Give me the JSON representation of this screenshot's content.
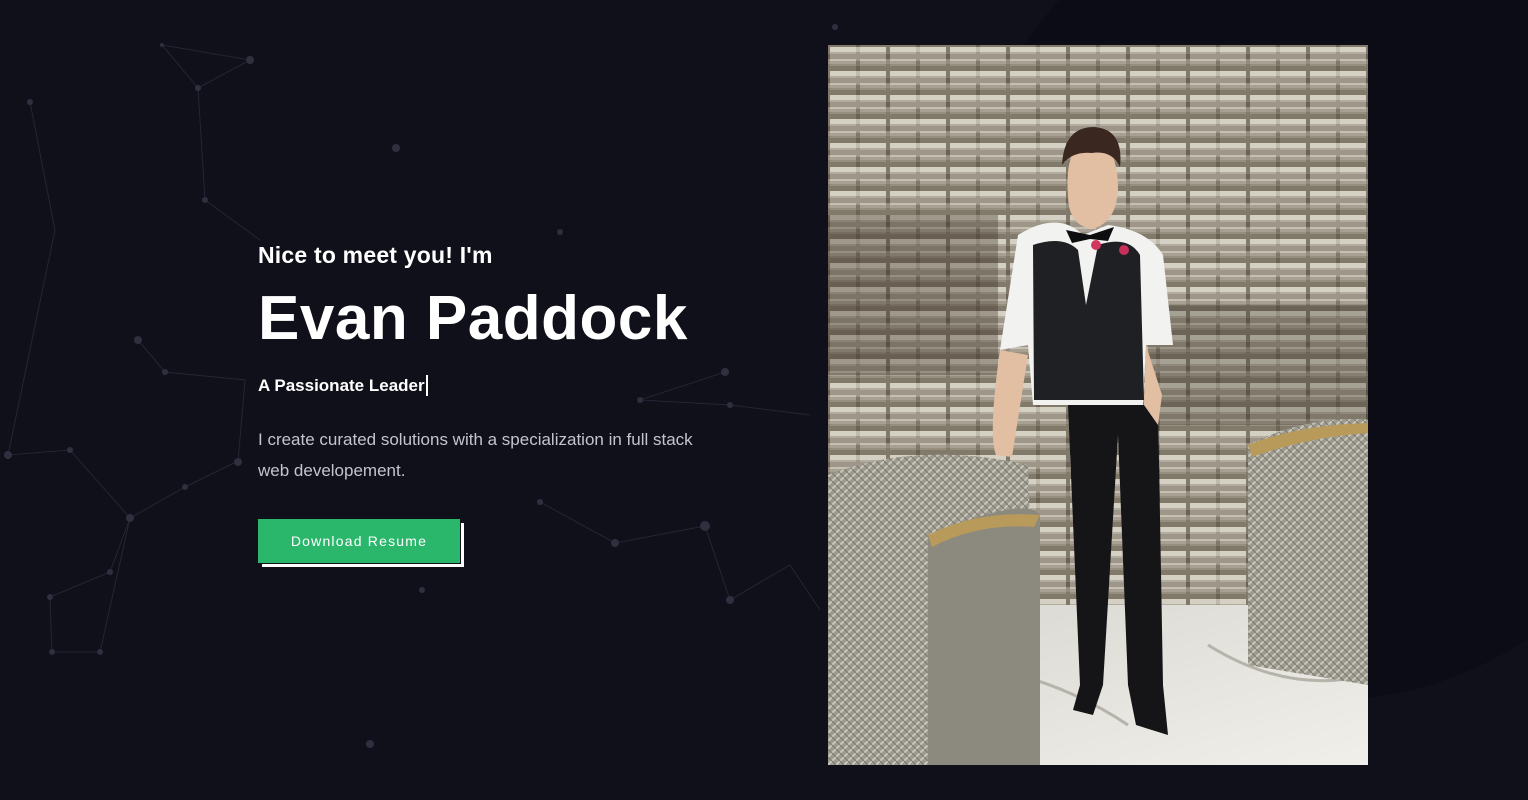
{
  "hero": {
    "greeting": "Nice to meet you! I'm",
    "name": "Evan Paddock",
    "tagline": "A Passionate Leader",
    "description": "I create curated solutions with a specialization in full stack web developement.",
    "button_label": "Download Resume"
  },
  "colors": {
    "background": "#10101b",
    "accent": "#2ab66b",
    "text": "#ffffff",
    "muted_text": "#c4c4d0"
  }
}
